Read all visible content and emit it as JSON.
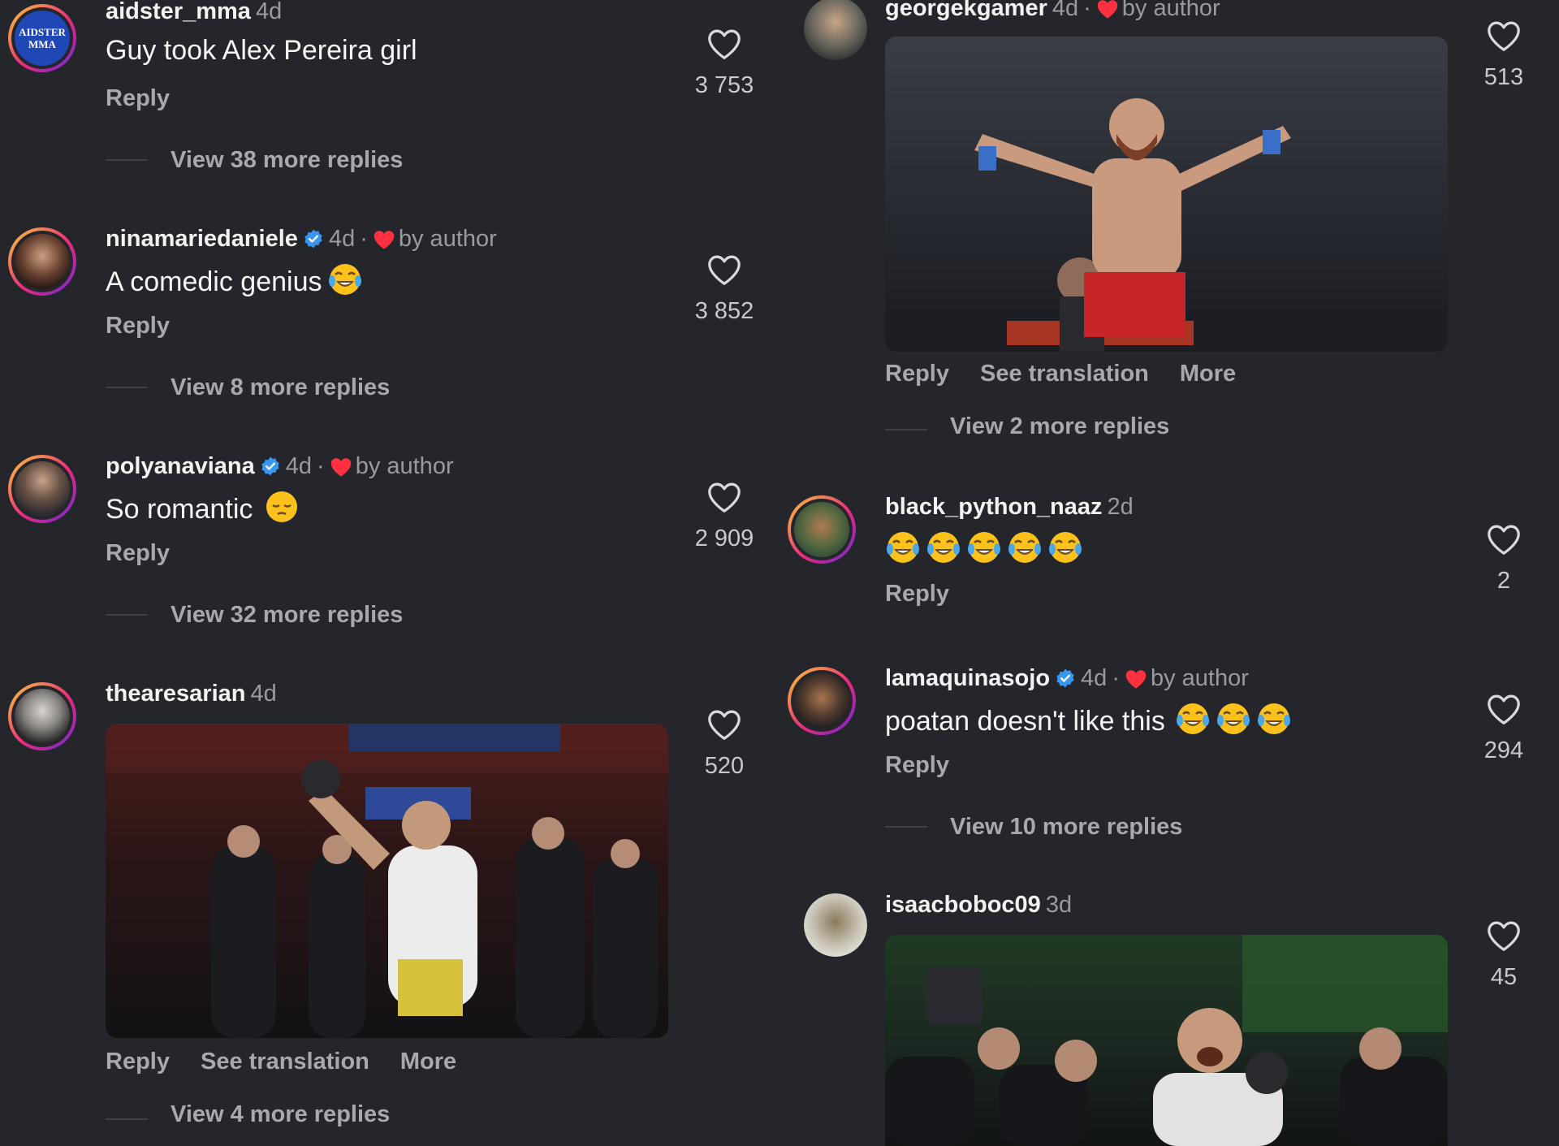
{
  "left_comments": [
    {
      "username": "aidster_mma",
      "time": "4d",
      "avatar_text": "AIDSTER\nMMA",
      "text": "Guy took Alex Pereira girl",
      "reply": "Reply",
      "likes": "3 753",
      "view_replies": "View 38 more replies"
    },
    {
      "username": "ninamariedaniele",
      "time": "4d",
      "by_author": "by author",
      "text": "A comedic genius",
      "reply": "Reply",
      "likes": "3 852",
      "view_replies": "View 8 more replies"
    },
    {
      "username": "polyanaviana",
      "time": "4d",
      "by_author": "by author",
      "text": "So romantic",
      "reply": "Reply",
      "likes": "2 909",
      "view_replies": "View 32 more replies"
    },
    {
      "username": "thearesarian",
      "time": "4d",
      "reply": "Reply",
      "see_translation": "See translation",
      "more": "More",
      "likes": "520",
      "view_replies": "View 4 more replies"
    }
  ],
  "right_comments": [
    {
      "username": "georgekgamer",
      "time": "4d",
      "by_author": "by author",
      "reply": "Reply",
      "see_translation": "See translation",
      "more": "More",
      "likes": "513",
      "view_replies": "View 2 more replies"
    },
    {
      "username": "black_python_naaz",
      "time": "2d",
      "reply": "Reply",
      "likes": "2"
    },
    {
      "username": "lamaquinasojo",
      "time": "4d",
      "by_author": "by author",
      "text": "poatan doesn't like this",
      "reply": "Reply",
      "likes": "294",
      "view_replies": "View 10 more replies"
    },
    {
      "username": "isaacboboc09",
      "time": "3d",
      "likes": "45"
    }
  ],
  "separator": "·",
  "icons": {
    "like": "heart-outline-icon",
    "verified": "verified-badge-icon",
    "author_like": "red-heart-icon",
    "emoji": "face-with-tears-of-joy-emoji",
    "pensive": "pensive-face-emoji"
  },
  "colors": {
    "background": "#25262c",
    "verified": "#3897f0",
    "author_heart": "#ff3040",
    "ring_gradient": [
      "#f9ce34",
      "#ee2a7b",
      "#6228d7"
    ]
  }
}
